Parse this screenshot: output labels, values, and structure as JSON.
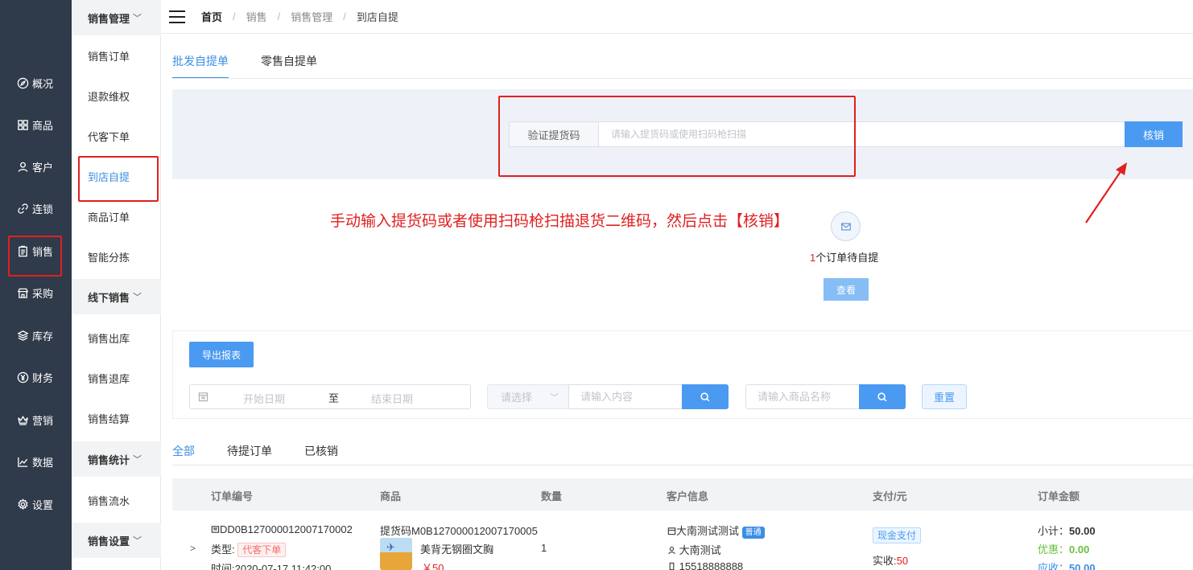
{
  "nav": {
    "items": [
      {
        "label": "概况",
        "icon": "compass-icon"
      },
      {
        "label": "商品",
        "icon": "grid-icon"
      },
      {
        "label": "客户",
        "icon": "user-icon"
      },
      {
        "label": "连锁",
        "icon": "link-icon"
      },
      {
        "label": "销售",
        "icon": "clipboard-icon"
      },
      {
        "label": "采购",
        "icon": "shop-icon"
      },
      {
        "label": "库存",
        "icon": "layers-icon"
      },
      {
        "label": "财务",
        "icon": "yen-icon"
      },
      {
        "label": "营销",
        "icon": "crown-icon"
      },
      {
        "label": "数据",
        "icon": "chart-icon"
      },
      {
        "label": "设置",
        "icon": "gear-icon"
      }
    ]
  },
  "submenu": {
    "group1": "销售管理",
    "items1": [
      "销售订单",
      "退款维权",
      "代客下单",
      "到店自提",
      "商品订单",
      "智能分拣"
    ],
    "group2": "线下销售",
    "items2": [
      "销售出库",
      "销售退库",
      "销售结算"
    ],
    "group3": "销售统计",
    "items3": [
      "销售流水"
    ],
    "group4": "销售设置"
  },
  "breadcrumb": {
    "home": "首页",
    "level1": "销售",
    "level2": "销售管理",
    "current": "到店自提"
  },
  "tabs": {
    "wholesale": "批发自提单",
    "retail": "零售自提单"
  },
  "verify": {
    "label": "验证提货码",
    "placeholder": "请输入提货码或使用扫码枪扫描",
    "button": "核销"
  },
  "annotation": "手动输入提货码或者使用扫码枪扫描退货二维码，然后点击【核销】",
  "pending": {
    "count": "1",
    "text": "个订单待自提",
    "button": "查看"
  },
  "filter": {
    "export": "导出报表",
    "start_placeholder": "开始日期",
    "to": "至",
    "end_placeholder": "结束日期",
    "select_placeholder": "请选择",
    "content_placeholder": "请输入内容",
    "goods_placeholder": "请输入商品名称",
    "reset": "重置"
  },
  "status_tabs": [
    "全部",
    "待提订单",
    "已核销"
  ],
  "table": {
    "headers": [
      "订单编号",
      "商品",
      "数量",
      "客户信息",
      "支付/元",
      "订单金额"
    ],
    "row": {
      "order_no": "DD0B127000012007170002",
      "type_label": "类型:",
      "type_tag": "代客下单",
      "time": "时间:2020-07-17 11:42:00",
      "pickup_code": "提货码M0B127000012007170005",
      "product_name": "美背无钢圈文胸",
      "product_price": "￥50",
      "quantity": "1",
      "customer_store": "大南测试测试",
      "customer_level": "普通",
      "customer_name": "大南测试",
      "customer_phone": "15518888888",
      "pay_method": "现金支付",
      "paid_label": "实收:",
      "paid_value": "50",
      "subtotal_label": "小计：",
      "subtotal": "50.00",
      "discount_label": "优惠：",
      "discount": "0.00",
      "due_label": "应收：",
      "due": "50.00"
    }
  },
  "colors": {
    "nav_bg": "#2f3a4a",
    "accent": "#3a8ee6",
    "annotation_red": "#e02020"
  }
}
